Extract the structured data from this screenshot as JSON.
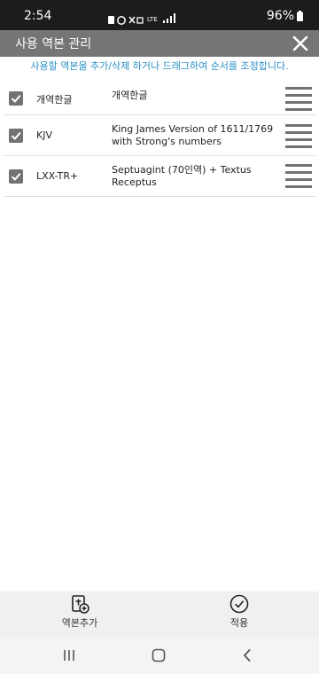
{
  "status_bar": {
    "time": "2:54",
    "battery": "96%"
  },
  "header": {
    "title": "사용 역본 관리"
  },
  "hint": "사용할 역본을 추가/삭제 하거나 드래그하여 순서를 조정합니다.",
  "versions": [
    {
      "abbr": "개역한글",
      "name": "개역한글",
      "checked": true
    },
    {
      "abbr": "KJV",
      "name": "King James Version of 1611/1769 with Strong's numbers",
      "checked": true
    },
    {
      "abbr": "LXX-TR+",
      "name": "Septuagint (70인역) + Textus Receptus",
      "checked": true
    }
  ],
  "bottom": {
    "add_label": "역본추가",
    "apply_label": "적용"
  },
  "colors": {
    "header_bg": "#757575",
    "hint_text": "#2a8fc4",
    "checkbox": "#727272"
  }
}
